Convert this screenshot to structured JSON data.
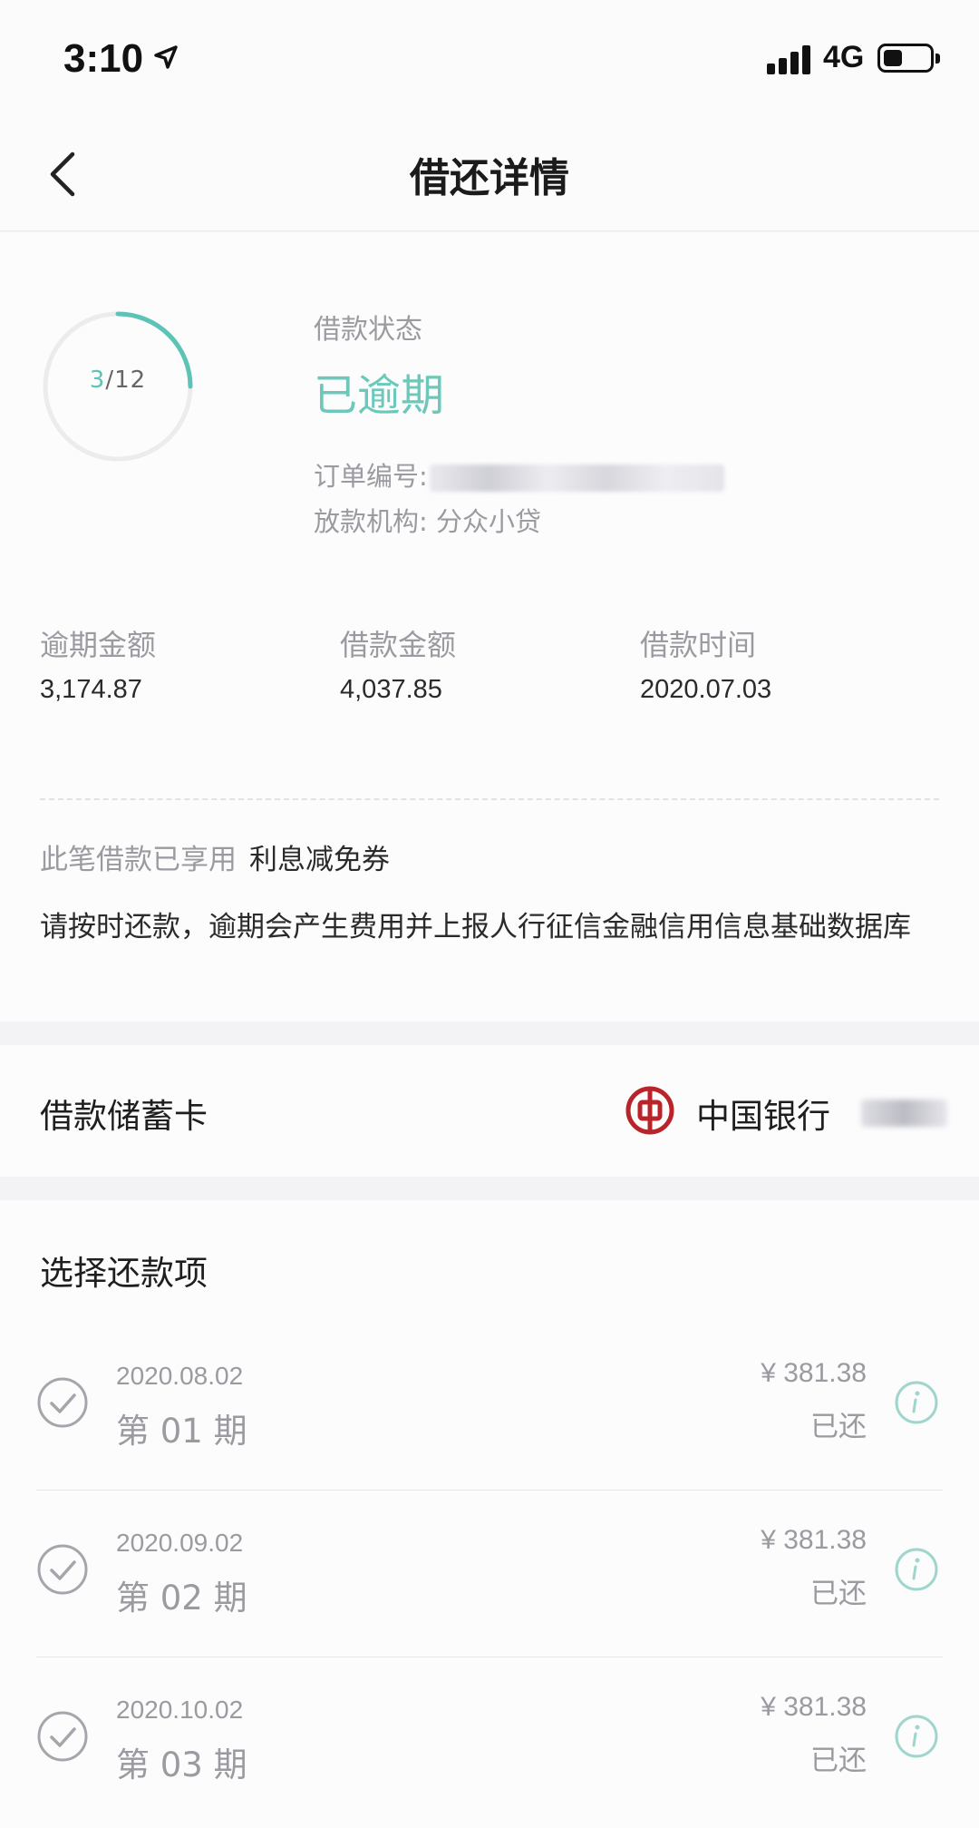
{
  "status_bar": {
    "time": "3:10",
    "network": "4G"
  },
  "header": {
    "title": "借还详情"
  },
  "loan_status": {
    "progress_current": "3",
    "progress_total": "/12",
    "progress_fraction": 0.25,
    "ring_color": "#5cc3b6",
    "label": "借款状态",
    "value": "已逾期",
    "order_label": "订单编号:",
    "lender": "放款机构: 分众小贷"
  },
  "stats": [
    {
      "label": "逾期金额",
      "value": "3,174.87"
    },
    {
      "label": "借款金额",
      "value": "4,037.85"
    },
    {
      "label": "借款时间",
      "value": "2020.07.03"
    }
  ],
  "coupon": {
    "prefix": "此笔借款已享用",
    "name": "利息减免券"
  },
  "notice": "请按时还款，逾期会产生费用并上报人行征信金融信用信息基础数据库",
  "debit_card": {
    "label": "借款储蓄卡",
    "bank": "中国银行"
  },
  "repayment": {
    "title": "选择还款项",
    "items": [
      {
        "date": "2020.08.02",
        "period": "第 01 期",
        "amount": "¥ 381.38",
        "status": "已还"
      },
      {
        "date": "2020.09.02",
        "period": "第 02 期",
        "amount": "¥ 381.38",
        "status": "已还"
      },
      {
        "date": "2020.10.02",
        "period": "第 03 期",
        "amount": "¥ 381.38",
        "status": "已还"
      }
    ]
  }
}
